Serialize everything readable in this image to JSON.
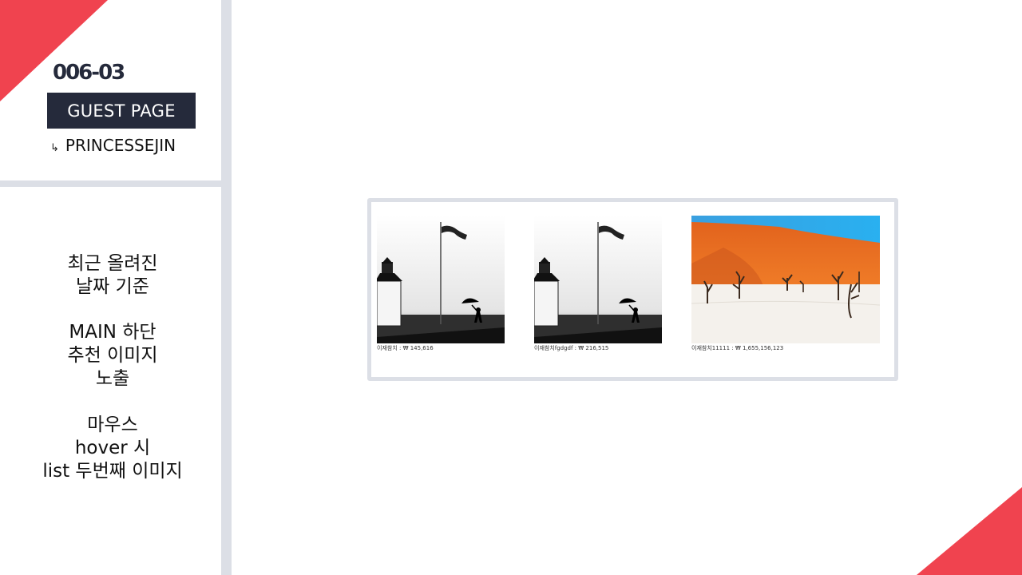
{
  "header": {
    "code": "006-03",
    "guest_label": "GUEST PAGE",
    "author_arrow": "↳",
    "author": "PRINCESSEJIN"
  },
  "description": [
    [
      "최근 올려진",
      "날짜 기준"
    ],
    [
      "MAIN 하단",
      "추천 이미지",
      "노출"
    ],
    [
      "마우스",
      "hover 시",
      "list 두번째 이미지"
    ]
  ],
  "products": [
    {
      "name": "이재참치",
      "price": "₩ 145,616",
      "caption": "이재참치 : ₩ 145,616",
      "image": "lighthouse-flag-photo"
    },
    {
      "name": "이재참치fgdgdf",
      "price": "₩ 216,515",
      "caption": "이재참치fgdgdf : ₩ 216,515",
      "image": "lighthouse-flag-photo"
    },
    {
      "name": "이재참치11111",
      "price": "₩ 1,655,156,123",
      "caption": "이재참치11111 : ₩ 1,655,156,123",
      "image": "desert-dune-photo"
    }
  ],
  "colors": {
    "accent": "#f0434f",
    "dark": "#252a3b",
    "divider": "#dcdfe6"
  }
}
